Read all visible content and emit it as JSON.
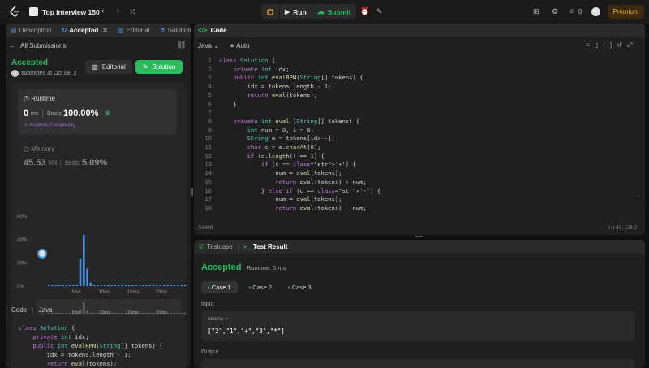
{
  "topbar": {
    "title": "Top Interview 150",
    "run_label": "Run",
    "submit_label": "Submit",
    "streak_count": "0",
    "premium_label": "Premium"
  },
  "left": {
    "tabs": [
      {
        "label": "Description"
      },
      {
        "label": "Accepted"
      },
      {
        "label": "Editorial"
      },
      {
        "label": "Solution"
      }
    ],
    "back_label": "All Submissions",
    "status": "Accepted",
    "submitted": "submitted at Oct 08, 2",
    "editorial_btn": "Editorial",
    "solution_btn": "Solution",
    "runtime": {
      "title": "Runtime",
      "value": "0",
      "unit": "ms",
      "beats_label": "Beats",
      "beats_value": "100.00%",
      "analyze_label": "Analyze Complexity"
    },
    "memory": {
      "title": "Memory",
      "value": "45.53",
      "unit": "MB",
      "beats_label": "Beats",
      "beats_value": "5.09%"
    },
    "dist_yticks": [
      "60%",
      "40%",
      "20%",
      "0%"
    ],
    "dist_xticks": [
      "5ms",
      "10ms",
      "15ms",
      "20ms"
    ],
    "dist_bars": [
      0,
      0,
      0,
      0,
      0,
      0,
      0,
      0,
      0,
      24,
      44,
      15,
      3,
      1,
      1,
      1,
      1,
      1,
      1,
      1,
      1,
      1,
      1,
      1,
      1,
      1,
      1,
      1,
      1,
      1,
      1,
      1,
      1,
      1,
      1,
      1,
      1,
      1,
      1,
      1
    ],
    "mini_bars": [
      0,
      0,
      0,
      0,
      0,
      0,
      0,
      0,
      0,
      4,
      12,
      3,
      1,
      1,
      1,
      1,
      1,
      1,
      1,
      1,
      1,
      1,
      1,
      1,
      1,
      1,
      1,
      1,
      1,
      1,
      1,
      1,
      1,
      1,
      1,
      1,
      1,
      1,
      1,
      1
    ],
    "mini_xticks": [
      "5ms",
      "10ms",
      "15ms",
      "20ms"
    ],
    "code_label": "Code",
    "lang_label": "Java",
    "code_lines": [
      "class Solution {",
      "    private int idx;",
      "    public int evalRPN(String[] tokens) {",
      "        idx = tokens.length - 1;",
      "        return eval(tokens);"
    ]
  },
  "code": {
    "title": "Code",
    "language": "Java",
    "autosave": "Auto",
    "status": "Saved",
    "cursor": "Ln 43, Col 2",
    "lines": [
      "class Solution {",
      "    private int idx;",
      "    public int evalRPN(String[] tokens) {",
      "        idx = tokens.length - 1;",
      "        return eval(tokens);",
      "    }",
      "",
      "    private int eval (String[] tokens) {",
      "        int num = 0, i = 0;",
      "        String e = tokens[idx--];",
      "        char c = e.charAt(0);",
      "        if (e.length() == 1) {",
      "            if (c == '+') {",
      "                num = eval(tokens);",
      "                return eval(tokens) + num;",
      "            } else if (c == '-') {",
      "                num = eval(tokens);",
      "                return eval(tokens) - num;"
    ]
  },
  "result": {
    "tabs": [
      {
        "label": "Testcase"
      },
      {
        "label": "Test Result"
      }
    ],
    "status": "Accepted",
    "runtime": "Runtime: 0 ms",
    "cases": [
      "Case 1",
      "Case 2",
      "Case 3"
    ],
    "input_label": "Input",
    "var_name": "tokens =",
    "var_value": "[\"2\",\"1\",\"+\",\"3\",\"*\"]",
    "output_label": "Output"
  },
  "colors": {
    "accepted": "#2cbb5d",
    "accent": "#f5a623",
    "link": "#a06bd9"
  }
}
